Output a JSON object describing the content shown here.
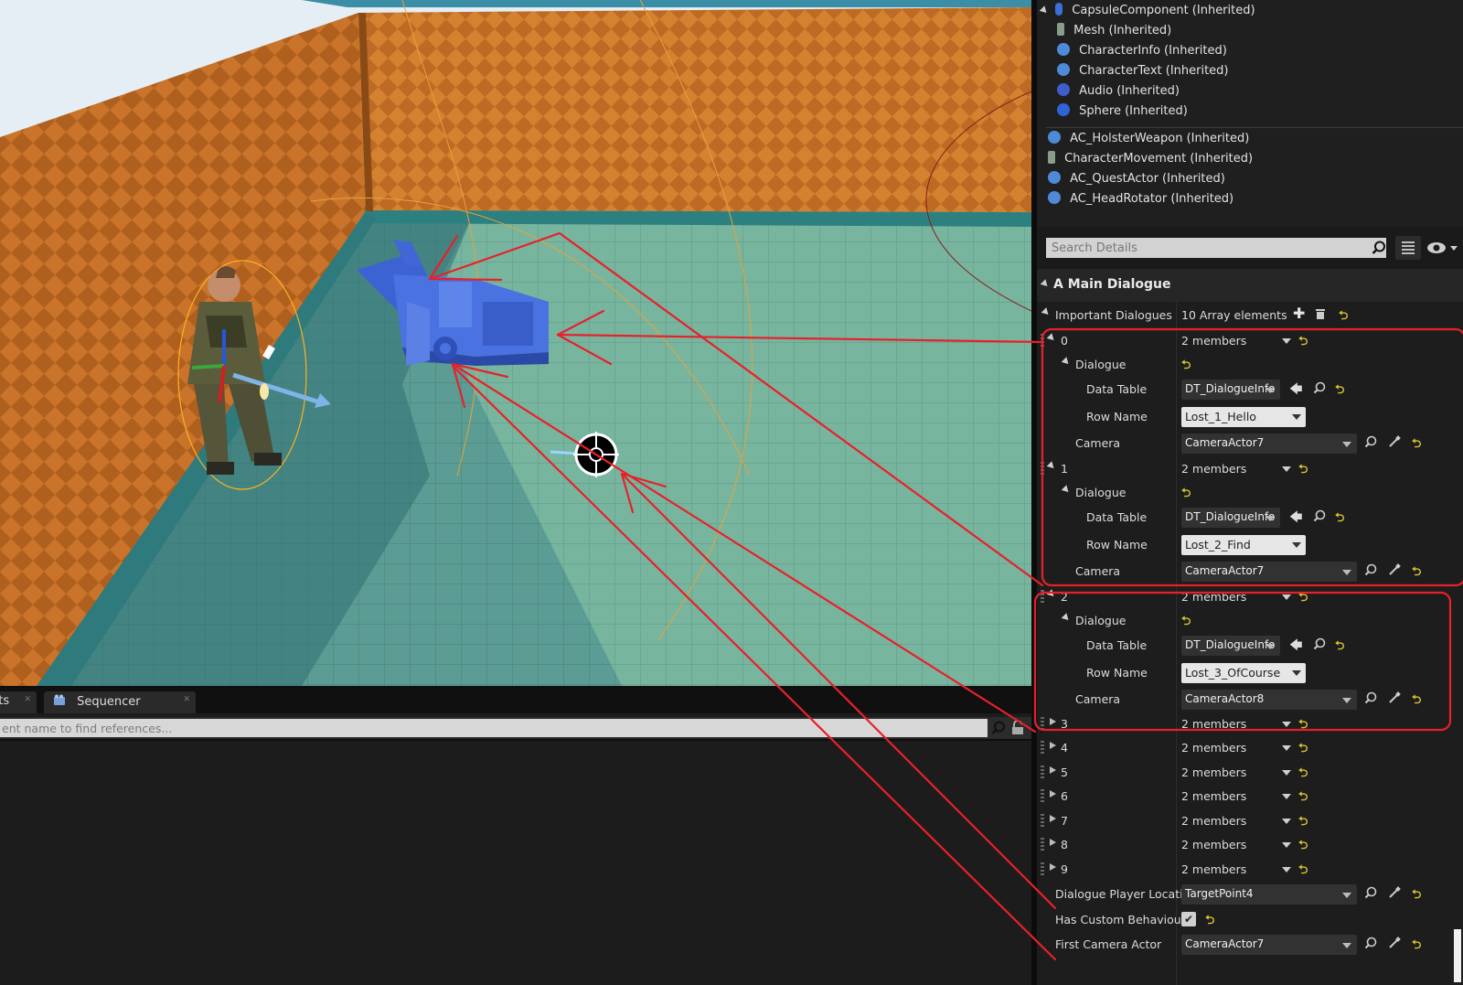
{
  "tree": {
    "items": [
      {
        "label": "CapsuleComponent (Inherited)",
        "icon": "capsule-icon"
      },
      {
        "label": "Mesh (Inherited)",
        "icon": "mesh-icon"
      },
      {
        "label": "CharacterInfo (Inherited)",
        "icon": "component-icon"
      },
      {
        "label": "CharacterText (Inherited)",
        "icon": "component-icon"
      },
      {
        "label": "Audio (Inherited)",
        "icon": "audio-icon"
      },
      {
        "label": "Sphere (Inherited)",
        "icon": "sphere-icon"
      },
      {
        "label": "AC_HolsterWeapon (Inherited)",
        "icon": "actor-component-icon"
      },
      {
        "label": "CharacterMovement (Inherited)",
        "icon": "movement-icon"
      },
      {
        "label": "AC_QuestActor (Inherited)",
        "icon": "actor-component-icon"
      },
      {
        "label": "AC_HeadRotator (Inherited)",
        "icon": "actor-component-icon"
      }
    ]
  },
  "details": {
    "search_placeholder": "Search Details",
    "category": "A Main Dialogue",
    "important_label": "Important Dialogues",
    "array_count": "10 Array elements",
    "elements": [
      {
        "index": "0",
        "members": "2 members",
        "dialogue": "Dialogue",
        "data_table_label": "Data Table",
        "data_table": "DT_DialogueInfo",
        "row_name_label": "Row Name",
        "row_name": "Lost_1_Hello",
        "camera_label": "Camera",
        "camera": "CameraActor7"
      },
      {
        "index": "1",
        "members": "2 members",
        "dialogue": "Dialogue",
        "data_table_label": "Data Table",
        "data_table": "DT_DialogueInfo",
        "row_name_label": "Row Name",
        "row_name": "Lost_2_Find",
        "camera_label": "Camera",
        "camera": "CameraActor7"
      },
      {
        "index": "2",
        "members": "2 members",
        "dialogue": "Dialogue",
        "data_table_label": "Data Table",
        "data_table": "DT_DialogueInfo",
        "row_name_label": "Row Name",
        "row_name": "Lost_3_OfCourse",
        "camera_label": "Camera",
        "camera": "CameraActor8"
      }
    ],
    "collapsed": [
      {
        "index": "3",
        "members": "2 members"
      },
      {
        "index": "4",
        "members": "2 members"
      },
      {
        "index": "5",
        "members": "2 members"
      },
      {
        "index": "6",
        "members": "2 members"
      },
      {
        "index": "7",
        "members": "2 members"
      },
      {
        "index": "8",
        "members": "2 members"
      },
      {
        "index": "9",
        "members": "2 members"
      }
    ],
    "player_location_label": "Dialogue Player Location",
    "player_location": "TargetPoint4",
    "custom_behaviour_label": "Has Custom Behaviour?",
    "first_camera_label": "First Camera Actor",
    "first_camera": "CameraActor7"
  },
  "bottom": {
    "tab_left": "nts",
    "tab_sequencer": "Sequencer",
    "search_placeholder": "ent name to find references..."
  },
  "colors": {
    "annotation": "#e8202a",
    "reset_arrow": "#d8c431",
    "camera_blue": "#4a6fd8"
  }
}
